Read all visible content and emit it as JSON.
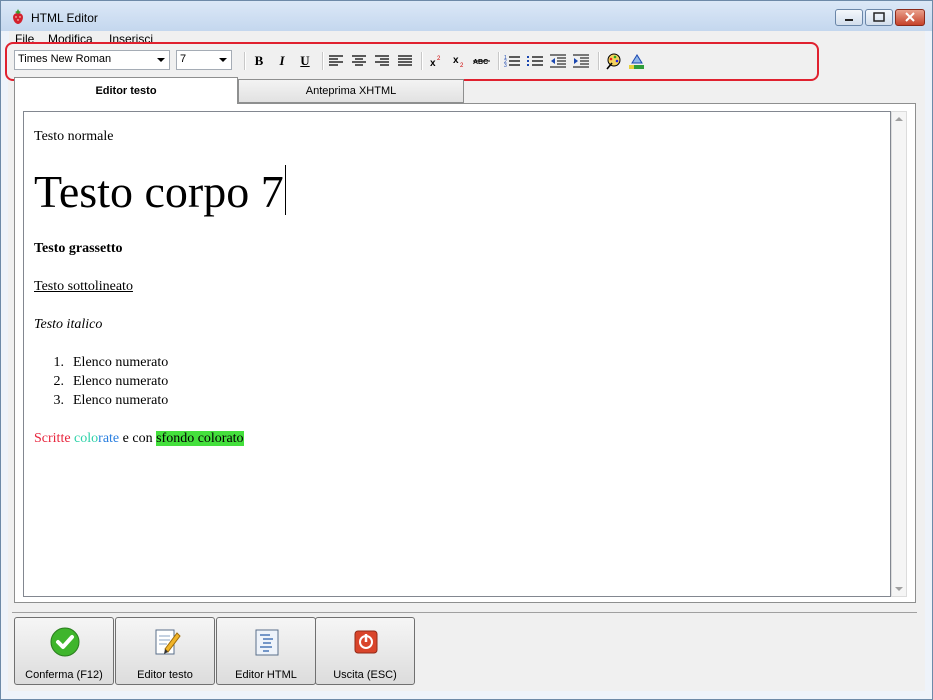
{
  "window": {
    "title": "HTML Editor"
  },
  "menu": {
    "items": [
      "File",
      "Modifica",
      "Inserisci"
    ]
  },
  "toolbar": {
    "font_family": "Times New Roman",
    "font_size": "7",
    "bold_label": "B",
    "italic_label": "I",
    "underline_label": "U",
    "icons": [
      "bold-icon",
      "italic-icon",
      "underline-icon",
      "align-left-icon",
      "align-center-icon",
      "align-right-icon",
      "justify-icon",
      "superscript-icon",
      "subscript-icon",
      "strikethrough-icon",
      "numbered-list-icon",
      "bullet-list-icon",
      "decrease-indent-icon",
      "increase-indent-icon",
      "text-color-icon",
      "highlight-color-icon"
    ]
  },
  "tabs": [
    {
      "label": "Editor testo",
      "active": true
    },
    {
      "label": "Anteprima XHTML",
      "active": false
    }
  ],
  "content": {
    "normal": "Testo normale",
    "large": "Testo corpo 7",
    "bold": "Testo grassetto",
    "underlined": "Testo sottolineato",
    "italic": "Testo italico",
    "list": [
      {
        "num": "1.",
        "text": "Elenco numerato"
      },
      {
        "num": "2.",
        "text": "Elenco numerato"
      },
      {
        "num": "3.",
        "text": "Elenco numerato"
      }
    ],
    "colored": {
      "part1": "Scritte",
      "part2_a": "colo",
      "part2_b": "rate",
      "part3": " e con ",
      "part4": "sfondo colorato",
      "colors": {
        "red": "#e8243c",
        "teal": "#2bd1a8",
        "blue": "#2a7fe0",
        "green_bg": "#44e03c"
      }
    }
  },
  "actions": [
    {
      "label": "Conferma (F12)",
      "icon": "check-icon"
    },
    {
      "label": "Editor testo",
      "icon": "edit-document-icon"
    },
    {
      "label": "Editor HTML",
      "icon": "html-document-icon"
    },
    {
      "label": "Uscita (ESC)",
      "icon": "power-icon"
    }
  ],
  "colors": {
    "highlight_border": "#e0212f",
    "confirm_green": "#3fb52c",
    "exit_red": "#d9452b"
  }
}
